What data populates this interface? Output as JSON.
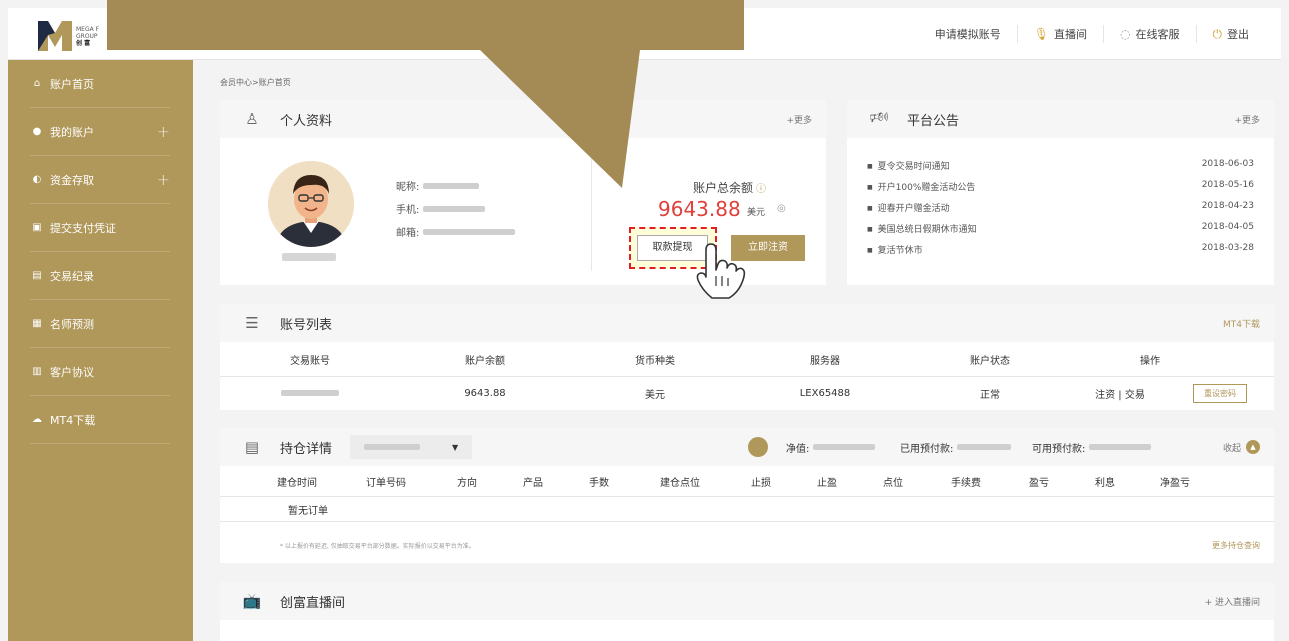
{
  "header": {
    "logo_lines": [
      "MEGA F",
      "GROUP",
      "创 富"
    ],
    "nav": [
      {
        "label": "申请模拟账号",
        "icon": ""
      },
      {
        "label": "直播间",
        "icon": "microphone-icon"
      },
      {
        "label": "在线客服",
        "icon": "headset-icon"
      },
      {
        "label": "登出",
        "icon": "power-icon"
      }
    ]
  },
  "sidebar": {
    "items": [
      {
        "label": "账户首页",
        "icon": "home-icon",
        "expandable": false
      },
      {
        "label": "我的账户",
        "icon": "user-icon",
        "expandable": true
      },
      {
        "label": "资金存取",
        "icon": "money-icon",
        "expandable": true
      },
      {
        "label": "提交支付凭证",
        "icon": "card-icon",
        "expandable": false
      },
      {
        "label": "交易纪录",
        "icon": "briefcase-icon",
        "expandable": false
      },
      {
        "label": "名师预测",
        "icon": "chart-icon",
        "expandable": false
      },
      {
        "label": "客户协议",
        "icon": "document-icon",
        "expandable": false
      },
      {
        "label": "MT4下载",
        "icon": "cloud-download-icon",
        "expandable": false
      }
    ],
    "plus": "+"
  },
  "breadcrumb": "会员中心>账户首页",
  "profile": {
    "title": "个人资料",
    "more": "+更多",
    "nickname_label": "昵称:",
    "phone_label": "手机:",
    "email_label": "邮箱:",
    "balance_label": "账户总余额",
    "balance_value": "9643.88",
    "balance_unit": "美元",
    "withdraw_btn": "取款提现",
    "deposit_btn": "立即注资"
  },
  "notice": {
    "title": "平台公告",
    "more": "+更多",
    "items": [
      {
        "text": "夏令交易时间通知",
        "date": "2018-06-03"
      },
      {
        "text": "开户100%赠金活动公告",
        "date": "2018-05-16"
      },
      {
        "text": "迎春开户赠金活动",
        "date": "2018-04-23"
      },
      {
        "text": "美国总统日假期休市通知",
        "date": "2018-04-05"
      },
      {
        "text": "复活节休市",
        "date": "2018-03-28"
      }
    ]
  },
  "accounts": {
    "title": "账号列表",
    "mt4": "MT4下载",
    "columns": [
      "交易账号",
      "账户余额",
      "货币种类",
      "服务器",
      "账户状态",
      "操作"
    ],
    "row": {
      "balance": "9643.88",
      "currency": "美元",
      "server": "LEX65488",
      "status": "正常",
      "ops": "注资 | 交易",
      "reset": "重设密码"
    }
  },
  "positions": {
    "title": "持仓详情",
    "net_label": "净值:",
    "used_label": "已用预付款:",
    "avail_label": "可用预付款:",
    "collapse": "收起",
    "columns": [
      "建仓时间",
      "订单号码",
      "方向",
      "产品",
      "手数",
      "建仓点位",
      "止损",
      "止盈",
      "点位",
      "手续费",
      "盈亏",
      "利息",
      "净盈亏"
    ],
    "empty": "暂无订单",
    "footnote": "* 以上报价有延迟, 仅抽取交易平台部分数据。实际报价以交易平台为准。",
    "more": "更多持仓查询"
  },
  "live": {
    "title": "创富直播间",
    "enter": "+ 进入直播间"
  },
  "colors": {
    "gold": "#b0975a",
    "balance_red": "#e0403b",
    "highlight_border": "#e02020"
  }
}
